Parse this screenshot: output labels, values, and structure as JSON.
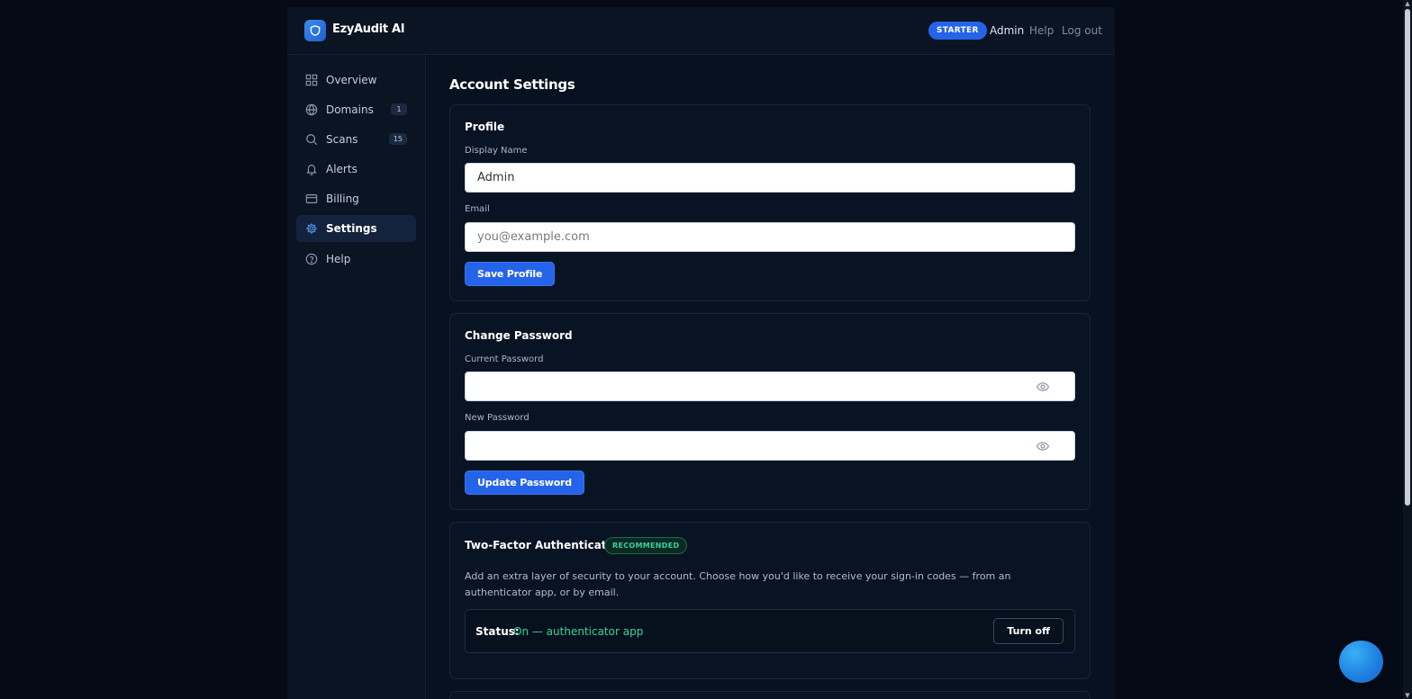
{
  "brand": {
    "name": "EzyAudit AI",
    "logo_icon": "shield-icon",
    "accent": "#2563eb"
  },
  "header": {
    "plan_badge": "STARTER",
    "user_link": "Admin",
    "help_link": "Help",
    "logout_link": "Log out"
  },
  "sidebar": {
    "items": [
      {
        "label": "Overview",
        "icon": "grid-icon",
        "count": null,
        "active": false
      },
      {
        "label": "Domains",
        "icon": "globe-icon",
        "count": "1",
        "active": false
      },
      {
        "label": "Scans",
        "icon": "search-icon",
        "count": "15",
        "active": false
      },
      {
        "label": "Alerts",
        "icon": "bell-icon",
        "count": null,
        "active": false
      },
      {
        "label": "Billing",
        "icon": "credit-card-icon",
        "count": null,
        "active": false
      },
      {
        "label": "Settings",
        "icon": "gear-icon",
        "count": null,
        "active": true
      },
      {
        "label": "Help",
        "icon": "help-circle-icon",
        "count": null,
        "active": false
      }
    ]
  },
  "page": {
    "title": "Account Settings"
  },
  "profile": {
    "title": "Profile",
    "display_name_label": "Display Name",
    "display_name_value": "Admin",
    "email_label": "Email",
    "email_placeholder": "you@example.com",
    "save_label": "Save Profile"
  },
  "password": {
    "title": "Change Password",
    "current_label": "Current Password",
    "new_label": "New Password",
    "update_label": "Update Password",
    "toggle_icon": "eye-icon"
  },
  "two_factor": {
    "title": "Two-Factor Authentication",
    "badge": "RECOMMENDED",
    "description": "Add an extra layer of security to your account. Choose how you'd like to receive your sign-in codes — from an authenticator app, or by email.",
    "status_label": "Status:",
    "status_value": "On — authenticator app",
    "turn_off_label": "Turn off",
    "status_color": "#34d399"
  },
  "chat": {
    "icon": "chat-bubble-icon"
  }
}
